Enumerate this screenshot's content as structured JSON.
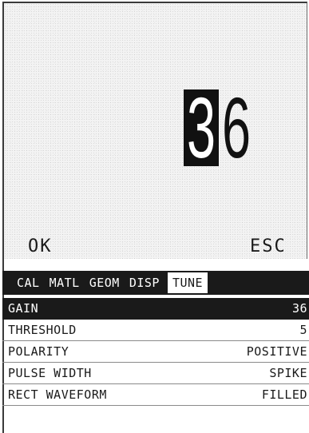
{
  "display": {
    "value_digits": [
      "3",
      "6"
    ],
    "softkeys": {
      "ok": "OK",
      "esc": "ESC"
    }
  },
  "tabs": [
    {
      "label": "CAL"
    },
    {
      "label": "MATL"
    },
    {
      "label": "GEOM"
    },
    {
      "label": "DISP"
    },
    {
      "label": "TUNE",
      "active": true
    }
  ],
  "menu": [
    {
      "label": "GAIN",
      "value": "36",
      "selected": true
    },
    {
      "label": "THRESHOLD",
      "value": "5"
    },
    {
      "label": "POLARITY",
      "value": "POSITIVE"
    },
    {
      "label": "PULSE WIDTH",
      "value": "SPIKE"
    },
    {
      "label": "RECT WAVEFORM",
      "value": "FILLED"
    }
  ],
  "colors": {
    "background": "#ffffff",
    "ink": "#1a1a1a",
    "highlight": "#1a1a1a"
  }
}
